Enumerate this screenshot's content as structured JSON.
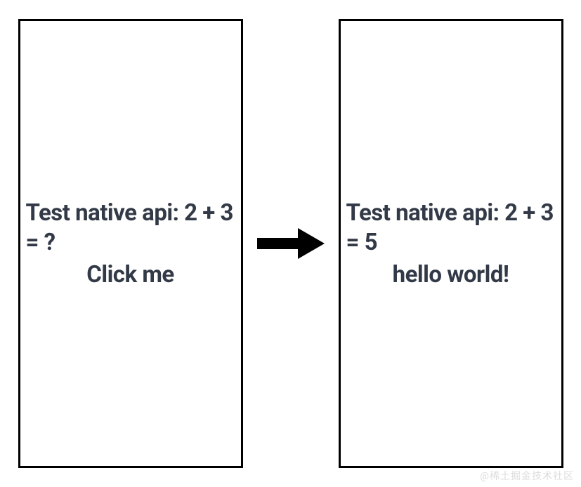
{
  "left": {
    "prompt": "Test native api: 2 + 3 = ?",
    "button_label": "Click me"
  },
  "right": {
    "prompt": "Test native api: 2 + 3 = 5",
    "button_label": "hello world!"
  },
  "watermark": "@稀土掘金技术社区"
}
